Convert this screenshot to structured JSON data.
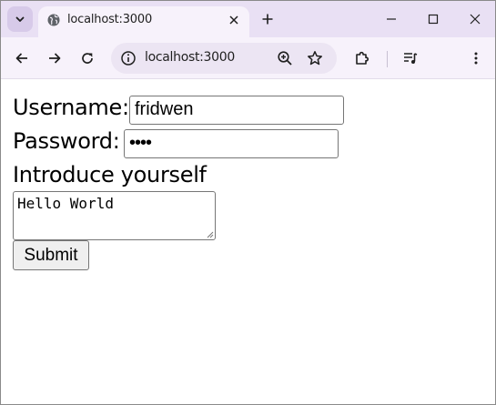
{
  "browser": {
    "tab": {
      "title": "localhost:3000",
      "favicon": "globe-icon"
    },
    "address_bar": {
      "url": "localhost:3000"
    },
    "accent_color": "#e9e0f4"
  },
  "form": {
    "username": {
      "label": "Username:",
      "value": "fridwen"
    },
    "password": {
      "label": "Password:",
      "value": "••••"
    },
    "introduce": {
      "label": "Introduce yourself",
      "value": "Hello World"
    },
    "submit_label": "Submit"
  }
}
